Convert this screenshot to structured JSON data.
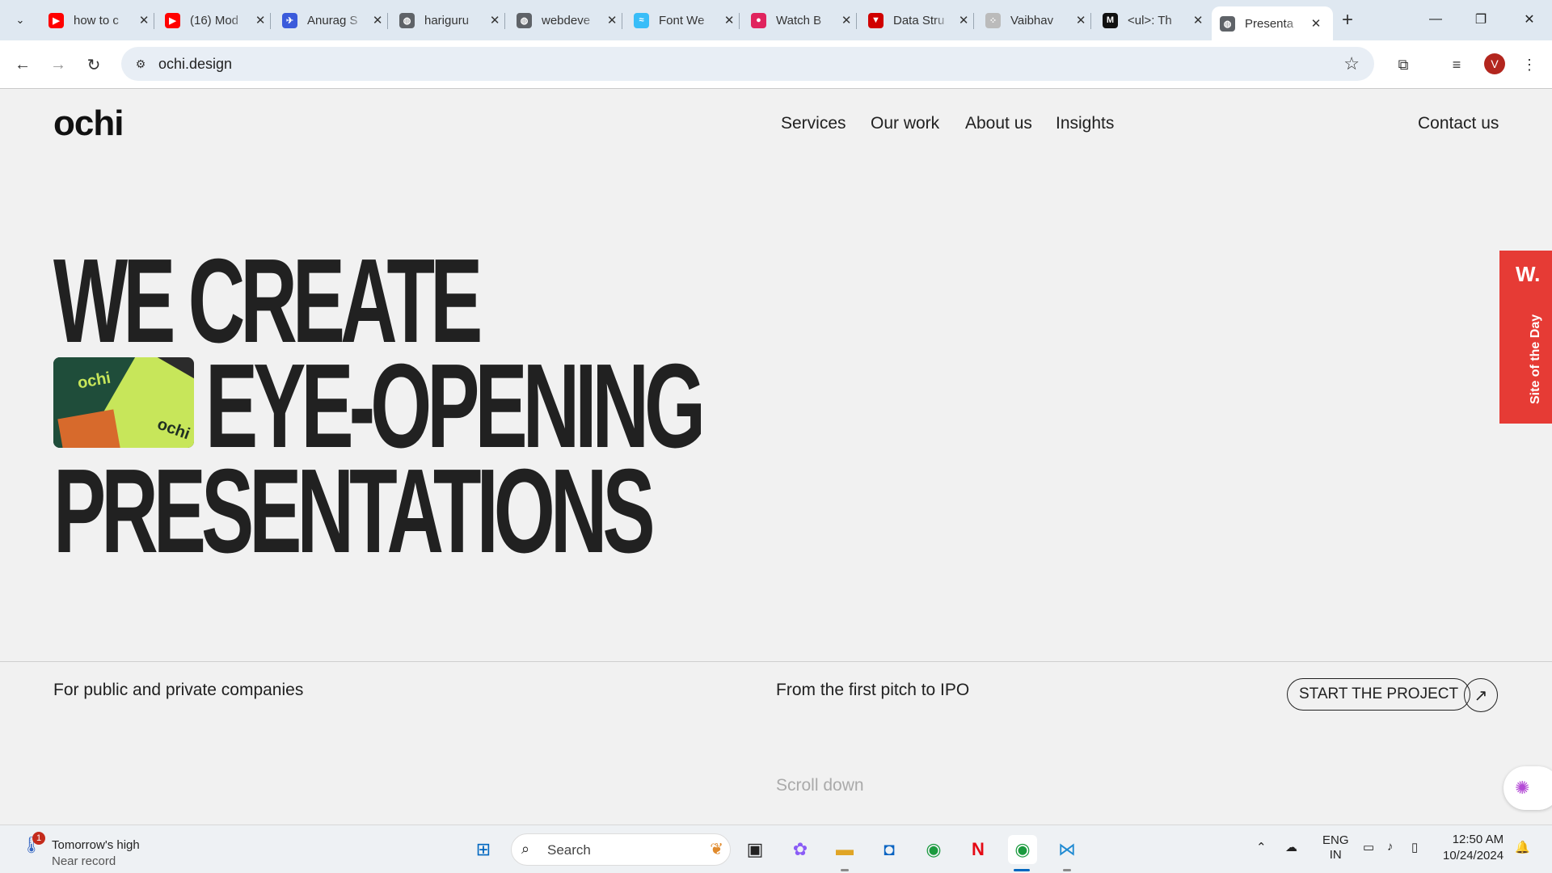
{
  "browser": {
    "tabs": [
      {
        "label": "how to c",
        "favicon": "youtube-icon",
        "color": "#ff0000",
        "glyph": "▶"
      },
      {
        "label": "(16) Mod",
        "favicon": "youtube-icon",
        "color": "#ff0000",
        "glyph": "▶"
      },
      {
        "label": "Anurag S",
        "favicon": "bird-icon",
        "color": "#3b5bdb",
        "glyph": "✈"
      },
      {
        "label": "hariguru",
        "favicon": "globe-icon",
        "color": "#5f6368",
        "glyph": "◍"
      },
      {
        "label": "webdeve",
        "favicon": "globe-icon",
        "color": "#5f6368",
        "glyph": "◍"
      },
      {
        "label": "Font We",
        "favicon": "tailwind-icon",
        "color": "#38bdf8",
        "glyph": "≈"
      },
      {
        "label": "Watch B",
        "favicon": "video-icon",
        "color": "#e0245e",
        "glyph": "●"
      },
      {
        "label": "Data Stru",
        "favicon": "triangle-icon",
        "color": "#d00000",
        "glyph": "▼"
      },
      {
        "label": "Vaibhav",
        "favicon": "dots-icon",
        "color": "#bbbbbb",
        "glyph": "⁘"
      },
      {
        "label": "<ul>: Th",
        "favicon": "mdn-icon",
        "color": "#111111",
        "glyph": "M"
      },
      {
        "label": "Presenta",
        "favicon": "globe-icon",
        "color": "#5f6368",
        "glyph": "◍",
        "active": true
      }
    ],
    "url": "ochi.design",
    "profile_initial": "V"
  },
  "site": {
    "logo": "ochi",
    "nav": [
      "Services",
      "Our work",
      "About us",
      "Insights"
    ],
    "contact": "Contact us",
    "hero": {
      "line1": "WE CREATE",
      "line2": "EYE-OPENING",
      "line3": "PRESENTATIONS",
      "image_text": "ochi"
    },
    "subtext_left": "For public and private companies",
    "subtext_mid": "From the first pitch to IPO",
    "cta": "START THE PROJECT",
    "scroll": "Scroll down",
    "badge": {
      "mark": "W.",
      "label": "Site of the Day",
      "color": "#e63b35"
    }
  },
  "taskbar": {
    "weather": {
      "line1": "Tomorrow's high",
      "line2": "Near record",
      "badge": "1"
    },
    "search_placeholder": "Search",
    "lang1": "ENG",
    "lang2": "IN",
    "time": "12:50 AM",
    "date": "10/24/2024"
  }
}
